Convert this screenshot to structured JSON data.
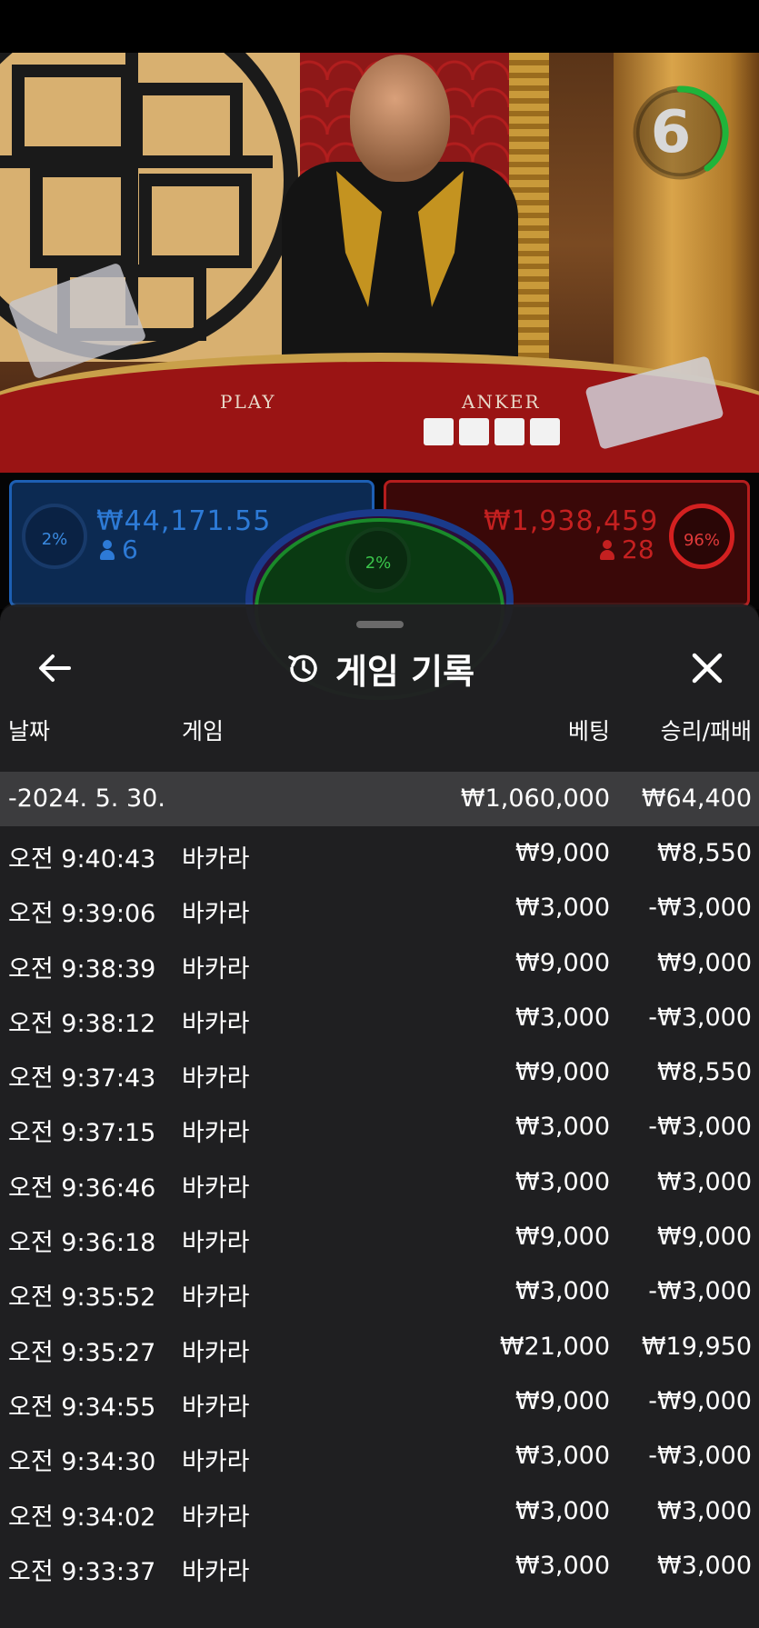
{
  "stream": {
    "timer_value": "6",
    "table_labels": {
      "left": "PLAY",
      "right": "ANKER"
    }
  },
  "bet_panel": {
    "player": {
      "percent": "2%",
      "amount": "₩44,171.55",
      "players": "6"
    },
    "tie": {
      "percent": "2%"
    },
    "banker": {
      "percent": "96%",
      "amount": "₩1,938,459",
      "players": "28"
    }
  },
  "history_sheet": {
    "title": "게임 기록",
    "columns": {
      "date": "날짜",
      "game": "게임",
      "bet": "베팅",
      "result": "승리/패배"
    },
    "day_group": {
      "date": "-2024. 5. 30.",
      "bet_total": "₩1,060,000",
      "result_total": "₩64,400"
    },
    "rows": [
      {
        "time": "오전 9:40:43",
        "game": "바카라",
        "bet": "₩9,000",
        "result": "₩8,550"
      },
      {
        "time": "오전 9:39:06",
        "game": "바카라",
        "bet": "₩3,000",
        "result": "-₩3,000"
      },
      {
        "time": "오전 9:38:39",
        "game": "바카라",
        "bet": "₩9,000",
        "result": "₩9,000"
      },
      {
        "time": "오전 9:38:12",
        "game": "바카라",
        "bet": "₩3,000",
        "result": "-₩3,000"
      },
      {
        "time": "오전 9:37:43",
        "game": "바카라",
        "bet": "₩9,000",
        "result": "₩8,550"
      },
      {
        "time": "오전 9:37:15",
        "game": "바카라",
        "bet": "₩3,000",
        "result": "-₩3,000"
      },
      {
        "time": "오전 9:36:46",
        "game": "바카라",
        "bet": "₩3,000",
        "result": "₩3,000"
      },
      {
        "time": "오전 9:36:18",
        "game": "바카라",
        "bet": "₩9,000",
        "result": "₩9,000"
      },
      {
        "time": "오전 9:35:52",
        "game": "바카라",
        "bet": "₩3,000",
        "result": "-₩3,000"
      },
      {
        "time": "오전 9:35:27",
        "game": "바카라",
        "bet": "₩21,000",
        "result": "₩19,950"
      },
      {
        "time": "오전 9:34:55",
        "game": "바카라",
        "bet": "₩9,000",
        "result": "-₩9,000"
      },
      {
        "time": "오전 9:34:30",
        "game": "바카라",
        "bet": "₩3,000",
        "result": "-₩3,000"
      },
      {
        "time": "오전 9:34:02",
        "game": "바카라",
        "bet": "₩3,000",
        "result": "₩3,000"
      },
      {
        "time": "오전 9:33:37",
        "game": "바카라",
        "bet": "₩3,000",
        "result": "₩3,000"
      }
    ]
  },
  "colors": {
    "player_blue": "#2d7ad6",
    "banker_red": "#c42020",
    "tie_green": "#3ac44a",
    "timer_green": "#1fb43a",
    "sheet_bg": "#202022",
    "day_row_bg": "#3c3c3e"
  },
  "icons": [
    "back-arrow-icon",
    "history-icon",
    "close-icon",
    "person-icon"
  ]
}
